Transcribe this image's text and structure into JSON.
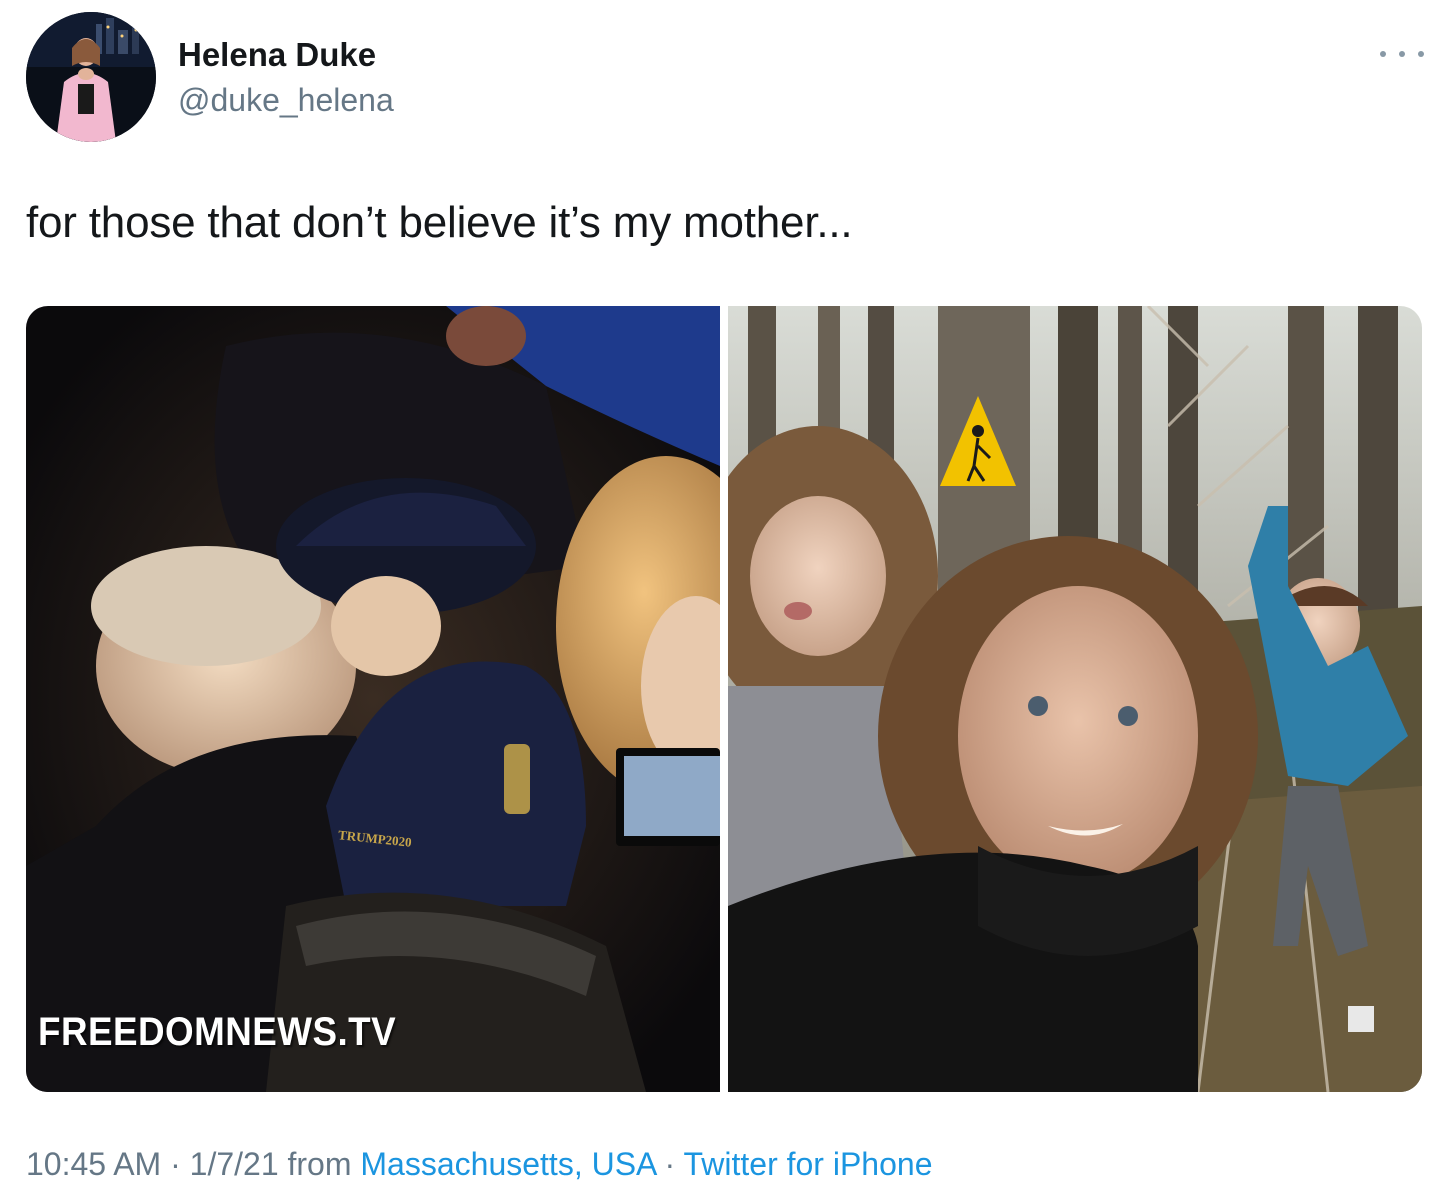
{
  "author": {
    "name": "Helena Duke",
    "handle": "@duke_helena"
  },
  "tweet": {
    "text": "for those that don’t believe it’s my mother..."
  },
  "media": {
    "left_watermark": "FREEDOMNEWS.TV",
    "cap_text": "TRUMP2020"
  },
  "meta": {
    "time": "10:45 AM",
    "separator": " · ",
    "date": "1/7/21",
    "from_label": " from ",
    "location": "Massachusetts, USA",
    "source": "Twitter for iPhone"
  },
  "colors": {
    "text_primary": "#14171a",
    "text_secondary": "#657786",
    "link": "#1b95e0"
  },
  "icons": {
    "more": "more-horizontal-icon"
  }
}
